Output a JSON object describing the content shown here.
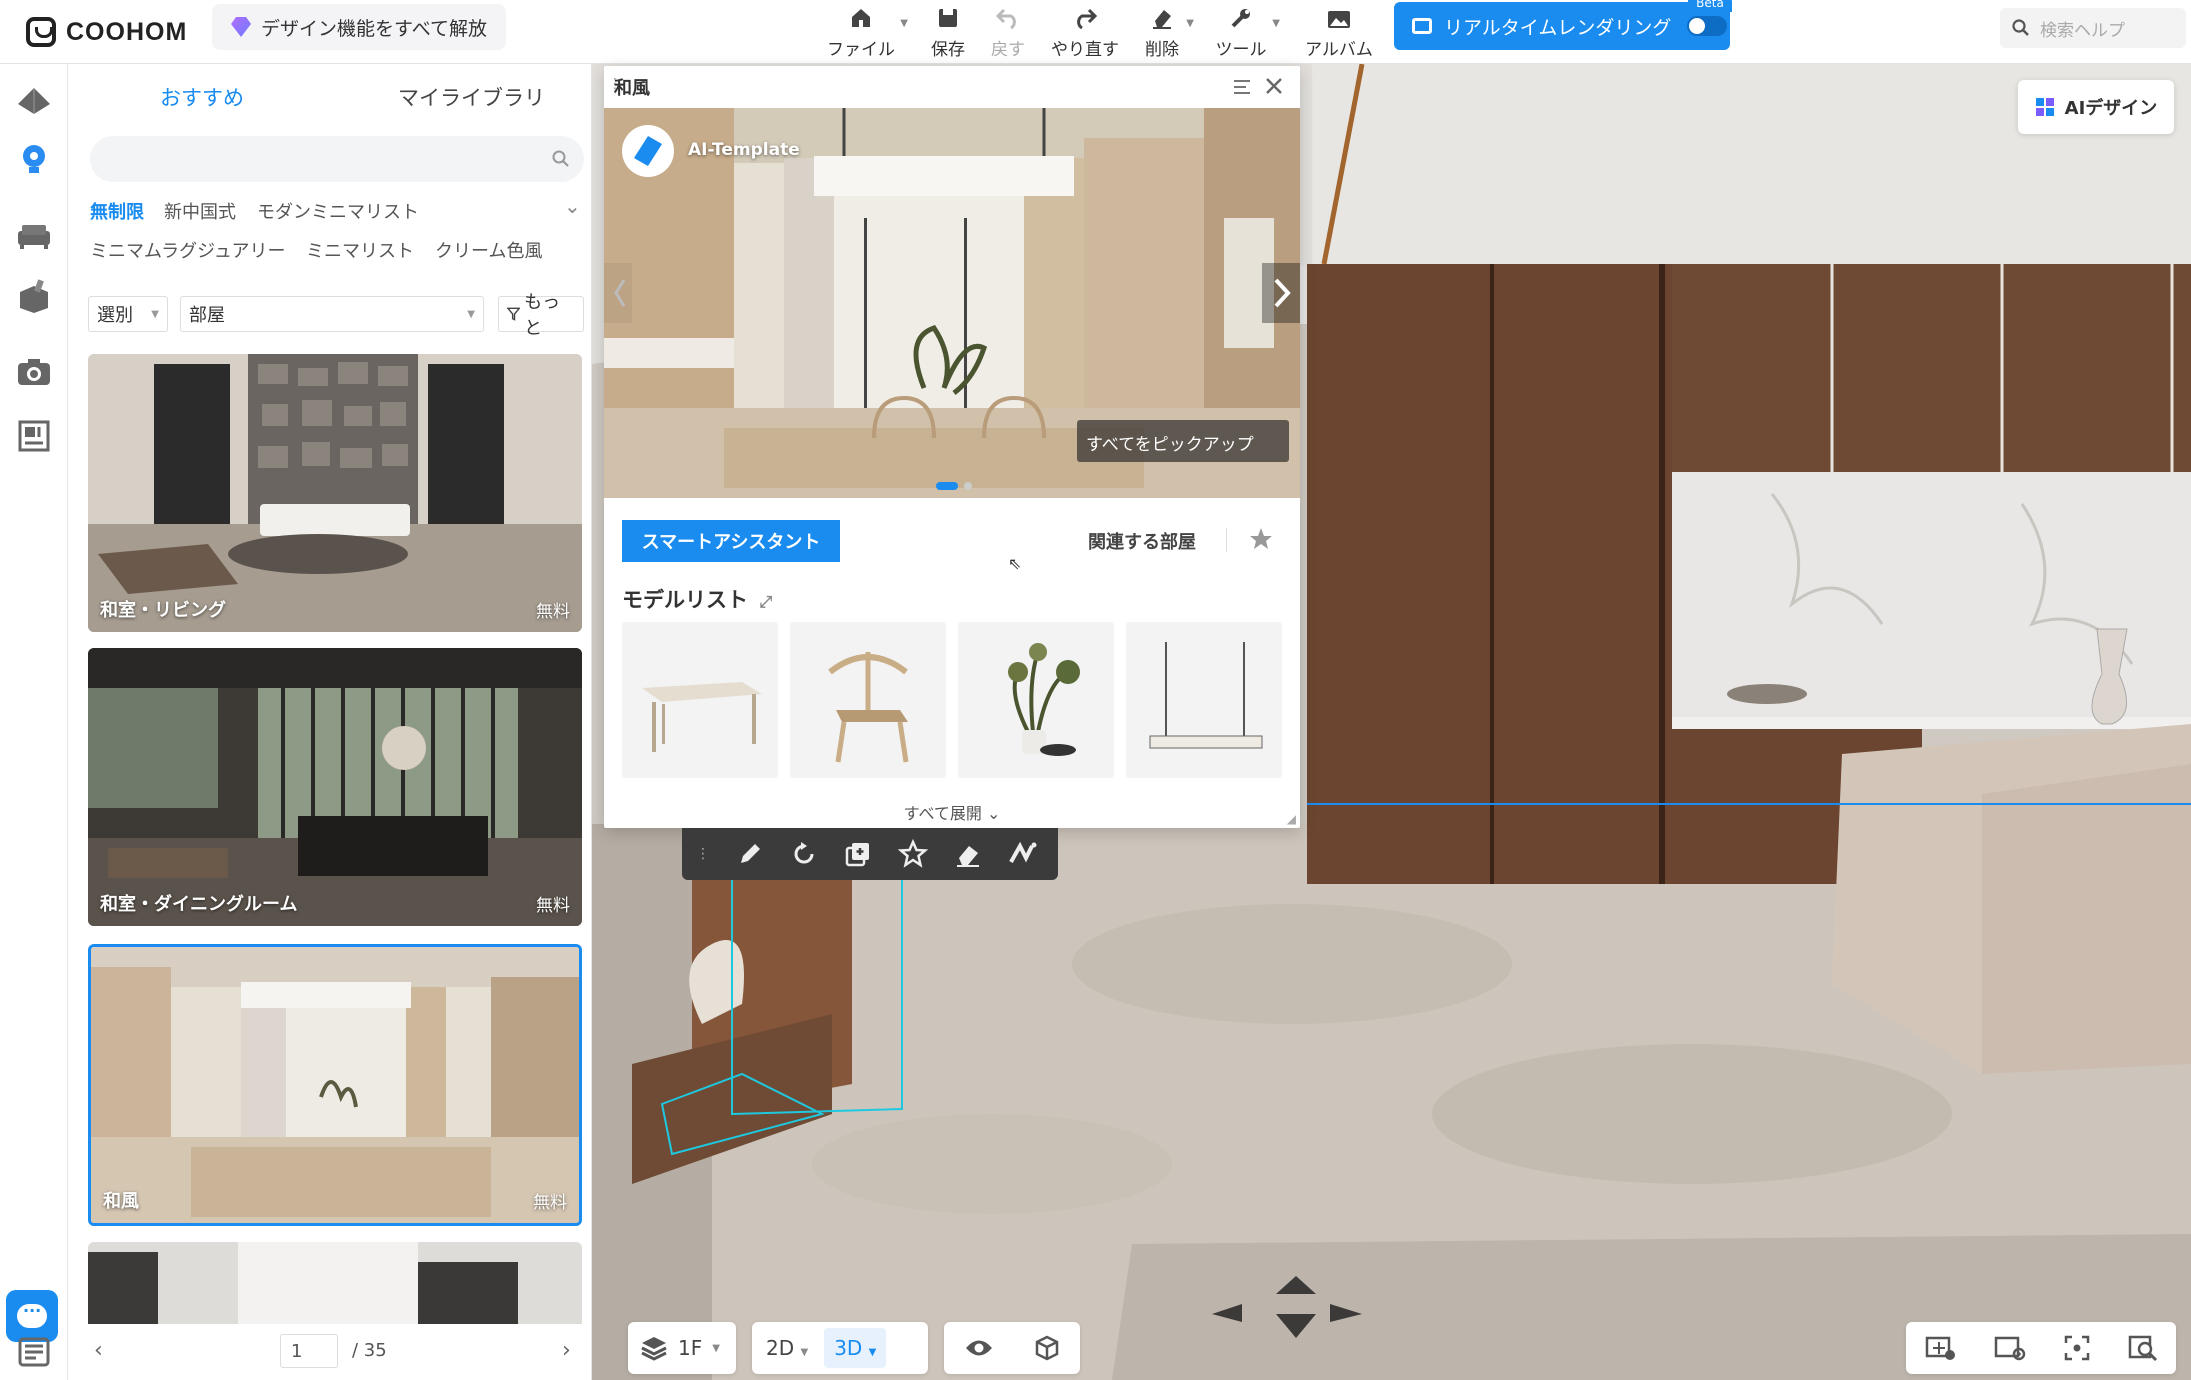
{
  "app": {
    "brand": "COOHOM"
  },
  "header": {
    "unlock_label": "デザイン機能をすべて解放",
    "tools": [
      {
        "label": "ファイル"
      },
      {
        "label": "保存"
      },
      {
        "label": "戻す"
      },
      {
        "label": "やり直す"
      },
      {
        "label": "削除"
      },
      {
        "label": "ツール"
      },
      {
        "label": "アルバム"
      }
    ],
    "render_label": "リアルタイムレンダリング",
    "beta": "Beta",
    "search_placeholder": "検索ヘルプ"
  },
  "library": {
    "tabs": [
      "おすすめ",
      "マイライブラリ"
    ],
    "style_tags": [
      "無制限",
      "新中国式",
      "モダンミニマリスト",
      "ミニマムラグジュアリー",
      "ミニマリスト",
      "クリーム色風"
    ],
    "filter_select": "選別",
    "filter_room": "部屋",
    "filter_more": "もっと",
    "cards": [
      {
        "name": "和室・リビング",
        "price": "無料"
      },
      {
        "name": "和室・ダイニングルーム",
        "price": "無料"
      },
      {
        "name": "和風",
        "price": "無料"
      }
    ],
    "pager": {
      "current": "1",
      "total": "/ 35"
    }
  },
  "popup": {
    "title": "和風",
    "badge": "AI-Template",
    "pick_all": "すべてをピックアップ",
    "assist_btn": "スマートアシスタント",
    "related_rooms": "関連する部屋",
    "model_list": "モデルリスト",
    "expand_all": "すべて展開"
  },
  "viewport": {
    "ai_design": "AIデザイン",
    "floor": "1F",
    "mode_2d": "2D",
    "mode_3d": "3D"
  },
  "colors": {
    "accent": "#1a8cf0",
    "wood": "#6b4530",
    "floor": "#cfc9c2"
  }
}
